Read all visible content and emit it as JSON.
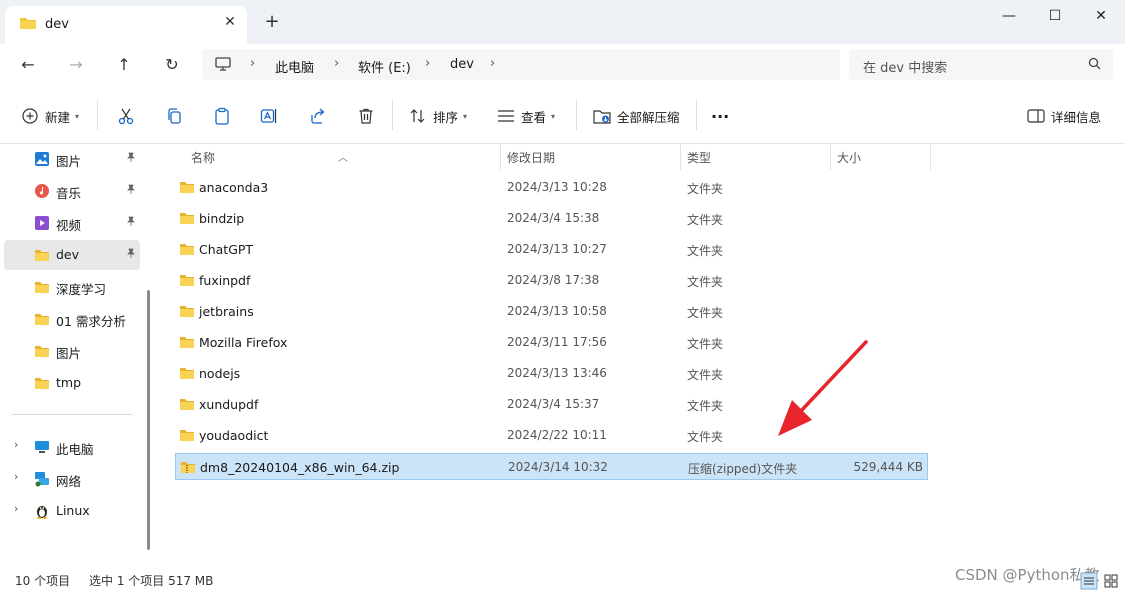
{
  "window": {
    "tab_title": "dev",
    "new_tab_symbol": "+",
    "close_symbol": "✕",
    "controls": {
      "minimize": "—",
      "maximize": "☐",
      "close": "✕"
    }
  },
  "nav": {
    "back_symbol": "←",
    "forward_symbol": "→",
    "up_symbol": "↑",
    "refresh_symbol": "↻",
    "breadcrumbs": [
      "此电脑",
      "软件 (E:)",
      "dev"
    ],
    "separator": "›",
    "search_placeholder": "在 dev 中搜索"
  },
  "toolbar": {
    "new_label": "新建",
    "sort_label": "排序",
    "view_label": "查看",
    "extract_label": "全部解压缩",
    "more_label": "···",
    "details_label": "详细信息"
  },
  "sidebar": {
    "pinned": [
      {
        "label": "图片",
        "icon": "pictures-icon",
        "pinned": true
      },
      {
        "label": "音乐",
        "icon": "music-icon",
        "pinned": true
      },
      {
        "label": "视频",
        "icon": "videos-icon",
        "pinned": true
      },
      {
        "label": "dev",
        "icon": "folder-icon",
        "pinned": true,
        "active": true
      },
      {
        "label": "深度学习",
        "icon": "folder-icon"
      },
      {
        "label": "01 需求分析",
        "icon": "folder-icon"
      },
      {
        "label": "图片",
        "icon": "folder-icon"
      },
      {
        "label": "tmp",
        "icon": "folder-icon"
      }
    ],
    "tree": [
      {
        "label": "此电脑",
        "icon": "pc-icon"
      },
      {
        "label": "网络",
        "icon": "network-icon"
      },
      {
        "label": "Linux",
        "icon": "linux-icon"
      }
    ],
    "pin_symbol": "📌",
    "chevron": "›"
  },
  "columns": {
    "name": "名称",
    "modified": "修改日期",
    "type": "类型",
    "size": "大小"
  },
  "files": [
    {
      "name": "anaconda3",
      "modified": "2024/3/13 10:28",
      "type": "文件夹",
      "size": ""
    },
    {
      "name": "bindzip",
      "modified": "2024/3/4 15:38",
      "type": "文件夹",
      "size": ""
    },
    {
      "name": "ChatGPT",
      "modified": "2024/3/13 10:27",
      "type": "文件夹",
      "size": ""
    },
    {
      "name": "fuxinpdf",
      "modified": "2024/3/8 17:38",
      "type": "文件夹",
      "size": ""
    },
    {
      "name": "jetbrains",
      "modified": "2024/3/13 10:58",
      "type": "文件夹",
      "size": ""
    },
    {
      "name": "Mozilla Firefox",
      "modified": "2024/3/11 17:56",
      "type": "文件夹",
      "size": ""
    },
    {
      "name": "nodejs",
      "modified": "2024/3/13 13:46",
      "type": "文件夹",
      "size": ""
    },
    {
      "name": "xundupdf",
      "modified": "2024/3/4 15:37",
      "type": "文件夹",
      "size": ""
    },
    {
      "name": "youdaodict",
      "modified": "2024/2/22 10:11",
      "type": "文件夹",
      "size": ""
    },
    {
      "name": "dm8_20240104_x86_win_64.zip",
      "modified": "2024/3/14 10:32",
      "type": "压缩(zipped)文件夹",
      "size": "529,444 KB",
      "selected": true
    }
  ],
  "status": {
    "item_count": "10 个项目",
    "selection": "选中 1 个项目  517 MB"
  },
  "watermark": "CSDN @Python私教",
  "colors": {
    "selection_bg": "#cce4f7",
    "folder": "#f3c33d",
    "accent": "#0067c0",
    "annotation_arrow": "#e8242c"
  }
}
